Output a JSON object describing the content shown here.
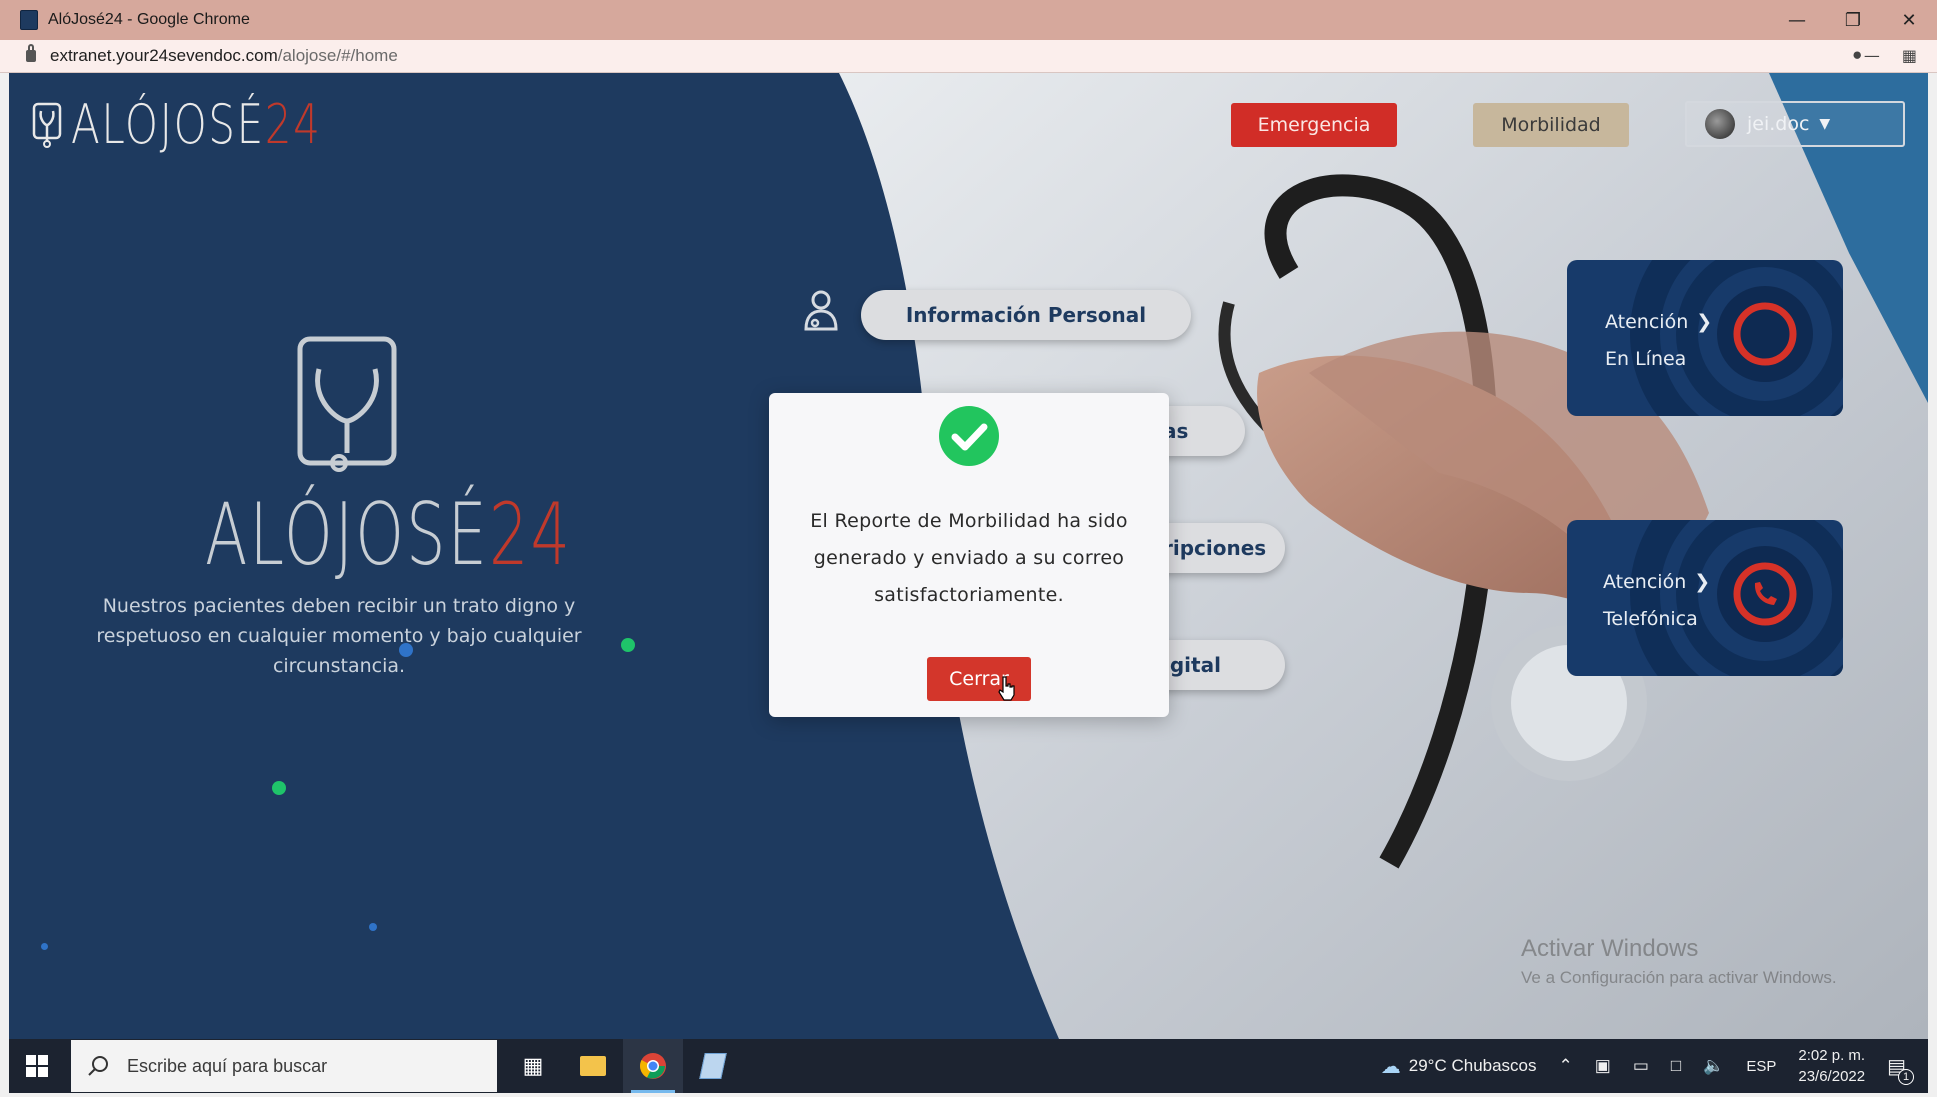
{
  "window": {
    "title": "AlóJosé24 - Google Chrome",
    "url_host": "extranet.your24sevendoc.com",
    "url_path": "/alojose/#/home"
  },
  "site": {
    "logo_text": "ALÓJOSÉ",
    "logo_num": "24",
    "nav": {
      "emergency_label": "Emergencia",
      "morbidity_label": "Morbilidad",
      "user_label": "jei.doc"
    },
    "tagline": "Nuestros pacientes deben recibir un trato digno y respetuoso en cualquier momento y bajo cualquier circunstancia.",
    "menu": [
      {
        "label": "Información Personal"
      },
      {
        "label": "as"
      },
      {
        "label": "ripciones"
      },
      {
        "label": "igital"
      }
    ],
    "cards": [
      {
        "line1": "Atención",
        "line2": "En Línea",
        "icon": "record-icon"
      },
      {
        "line1": "Atención",
        "line2": "Telefónica",
        "icon": "phone-icon"
      }
    ],
    "watermark": {
      "title": "Activar Windows",
      "subtitle": "Ve a Configuración para activar Windows."
    }
  },
  "modal": {
    "message": "El Reporte de Morbilidad ha sido generado y enviado a su correo satisfactoriamente.",
    "close_label": "Cerrar"
  },
  "taskbar": {
    "search_placeholder": "Escribe aquí para buscar",
    "weather": "29°C  Chubascos",
    "language": "ESP",
    "time": "2:02 p. m.",
    "date": "23/6/2022",
    "notification_count": "1"
  },
  "colors": {
    "brand_navy": "#1e3a5f",
    "brand_red": "#d12d27",
    "morbidity_btn": "#c7b79c",
    "success_green": "#22c55e"
  }
}
